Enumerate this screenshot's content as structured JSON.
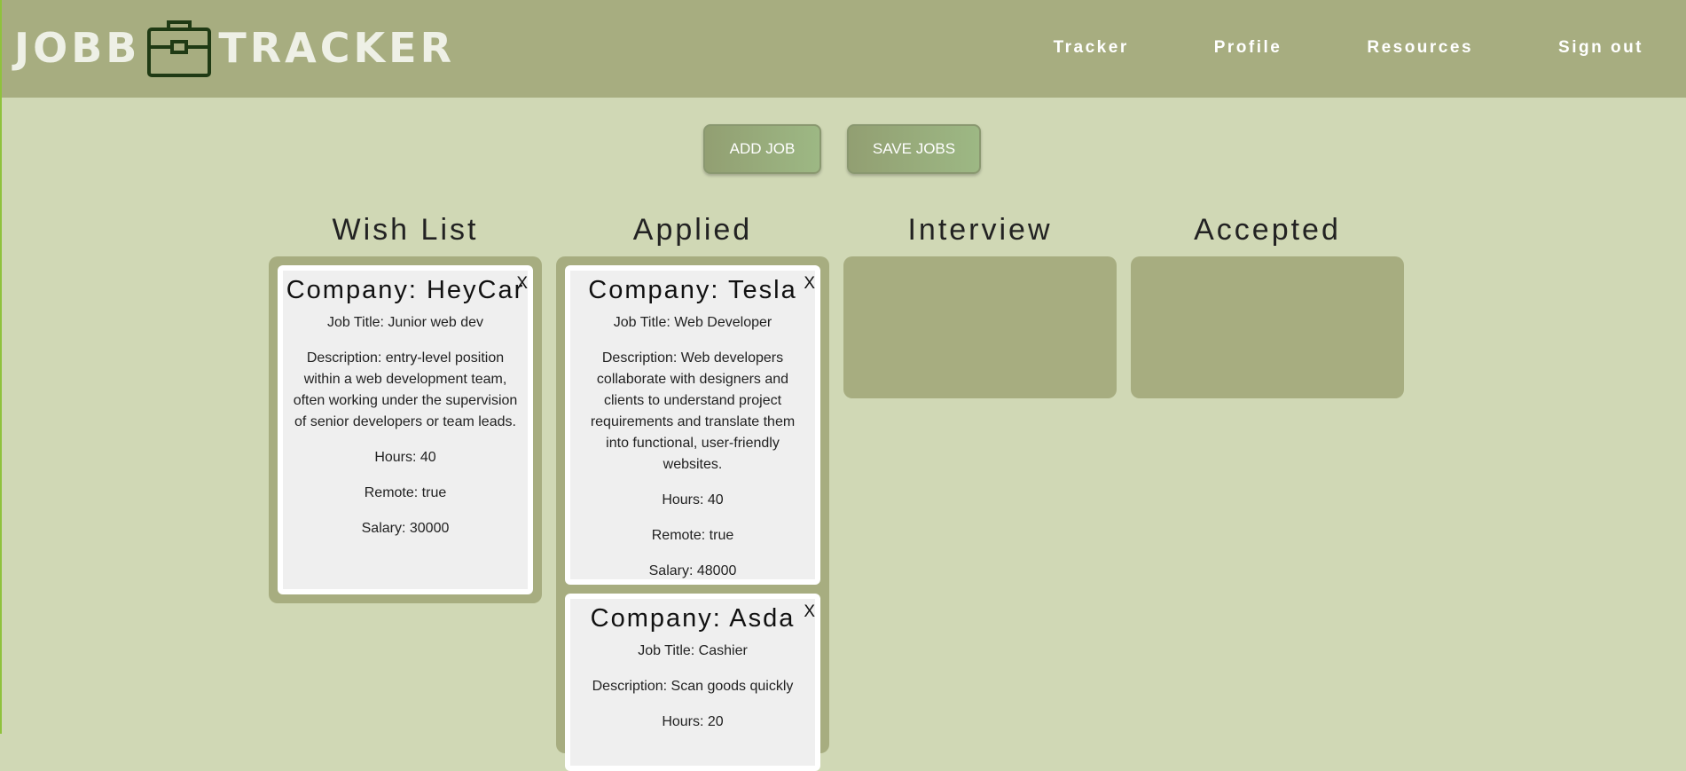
{
  "header": {
    "logo_left": "JOBB",
    "logo_right": "TRACKER",
    "nav": [
      "Tracker",
      "Profile",
      "Resources",
      "Sign out"
    ]
  },
  "actions": {
    "add_job": "ADD JOB",
    "save_jobs": "SAVE JOBS"
  },
  "columns": [
    {
      "title": "Wish List",
      "cards": [
        {
          "company": "Company: HeyCar",
          "job_title": "Job Title: Junior web dev",
          "description": "Description: entry-level position within a web development team, often working under the supervision of senior developers or team leads.",
          "hours": "Hours: 40",
          "remote": "Remote: true",
          "salary": "Salary: 30000"
        }
      ]
    },
    {
      "title": "Applied",
      "cards": [
        {
          "company": "Company: Tesla",
          "job_title": "Job Title: Web Developer",
          "description": "Description: Web developers collaborate with designers and clients to understand project requirements and translate them into functional, user-friendly websites.",
          "hours": "Hours: 40",
          "remote": "Remote: true",
          "salary": "Salary: 48000"
        },
        {
          "company": "Company: Asda",
          "job_title": "Job Title: Cashier",
          "description": "Description: Scan goods quickly",
          "hours": "Hours: 20"
        }
      ]
    },
    {
      "title": "Interview",
      "cards": []
    },
    {
      "title": "Accepted",
      "cards": []
    }
  ],
  "card_close_label": "X",
  "colors": {
    "header": "#a7ad80",
    "page": "#d0d8b5",
    "column": "#a7ad80",
    "card": "#efefef"
  }
}
